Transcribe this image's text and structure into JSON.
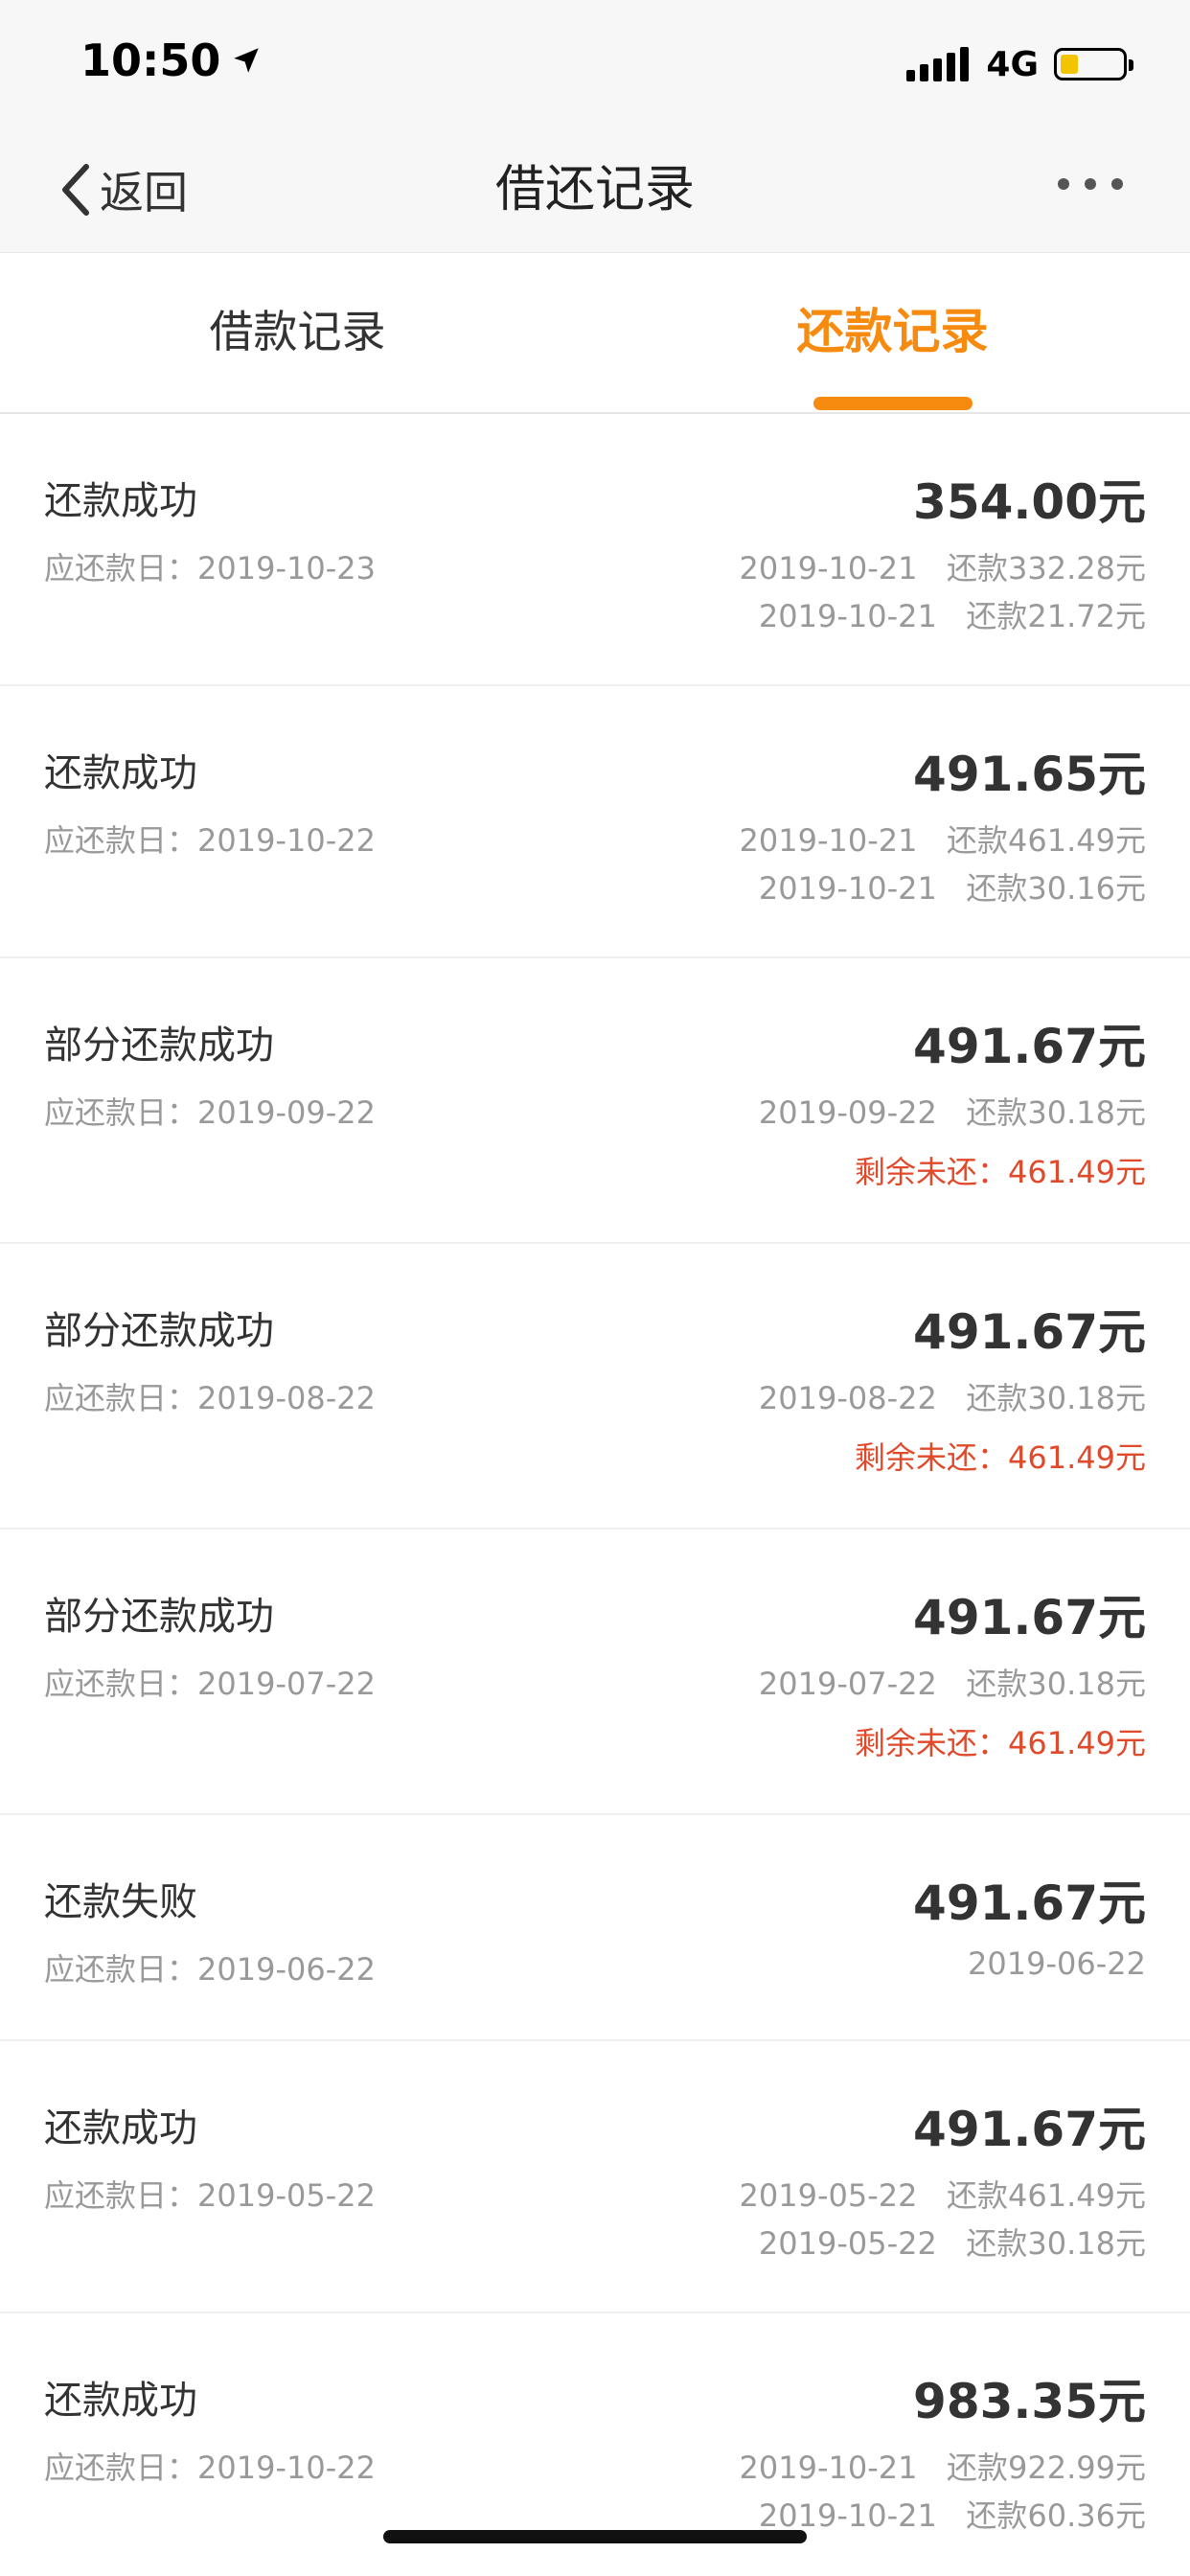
{
  "status_bar": {
    "time": "10:50",
    "network": "4G",
    "location_icon": "location-arrow-icon",
    "battery_color": "#f5c400"
  },
  "nav": {
    "back_label": "返回",
    "title": "借还记录",
    "more_icon": "more-dots-icon"
  },
  "tabs": {
    "borrow_label": "借款记录",
    "repay_label": "还款记录",
    "active": "repay",
    "accent_color": "#f78b10"
  },
  "records": [
    {
      "status": "还款成功",
      "due": "应还款日：2019-10-23",
      "amount": "354.00元",
      "lines": [
        {
          "text": "2019-10-21   还款332.28元",
          "red": false
        },
        {
          "text": "2019-10-21   还款21.72元",
          "red": false
        }
      ]
    },
    {
      "status": "还款成功",
      "due": "应还款日：2019-10-22",
      "amount": "491.65元",
      "lines": [
        {
          "text": "2019-10-21   还款461.49元",
          "red": false
        },
        {
          "text": "2019-10-21   还款30.16元",
          "red": false
        }
      ]
    },
    {
      "status": "部分还款成功",
      "due": "应还款日：2019-09-22",
      "amount": "491.67元",
      "lines": [
        {
          "text": "2019-09-22   还款30.18元",
          "red": false
        },
        {
          "text": "剩余未还：461.49元",
          "red": true
        }
      ]
    },
    {
      "status": "部分还款成功",
      "due": "应还款日：2019-08-22",
      "amount": "491.67元",
      "lines": [
        {
          "text": "2019-08-22   还款30.18元",
          "red": false
        },
        {
          "text": "剩余未还：461.49元",
          "red": true
        }
      ]
    },
    {
      "status": "部分还款成功",
      "due": "应还款日：2019-07-22",
      "amount": "491.67元",
      "lines": [
        {
          "text": "2019-07-22   还款30.18元",
          "red": false
        },
        {
          "text": "剩余未还：461.49元",
          "red": true
        }
      ]
    },
    {
      "status": "还款失败",
      "due": "应还款日：2019-06-22",
      "amount": "491.67元",
      "lines": [
        {
          "text": "2019-06-22",
          "red": false
        }
      ]
    },
    {
      "status": "还款成功",
      "due": "应还款日：2019-05-22",
      "amount": "491.67元",
      "lines": [
        {
          "text": "2019-05-22   还款461.49元",
          "red": false
        },
        {
          "text": "2019-05-22   还款30.18元",
          "red": false
        }
      ]
    },
    {
      "status": "还款成功",
      "due": "应还款日：2019-10-22",
      "amount": "983.35元",
      "lines": [
        {
          "text": "2019-10-21   还款922.99元",
          "red": false
        },
        {
          "text": "2019-10-21   还款60.36元",
          "red": false
        }
      ]
    }
  ],
  "colors": {
    "remaining_red": "#e04a2a",
    "secondary_gray": "#999999"
  }
}
